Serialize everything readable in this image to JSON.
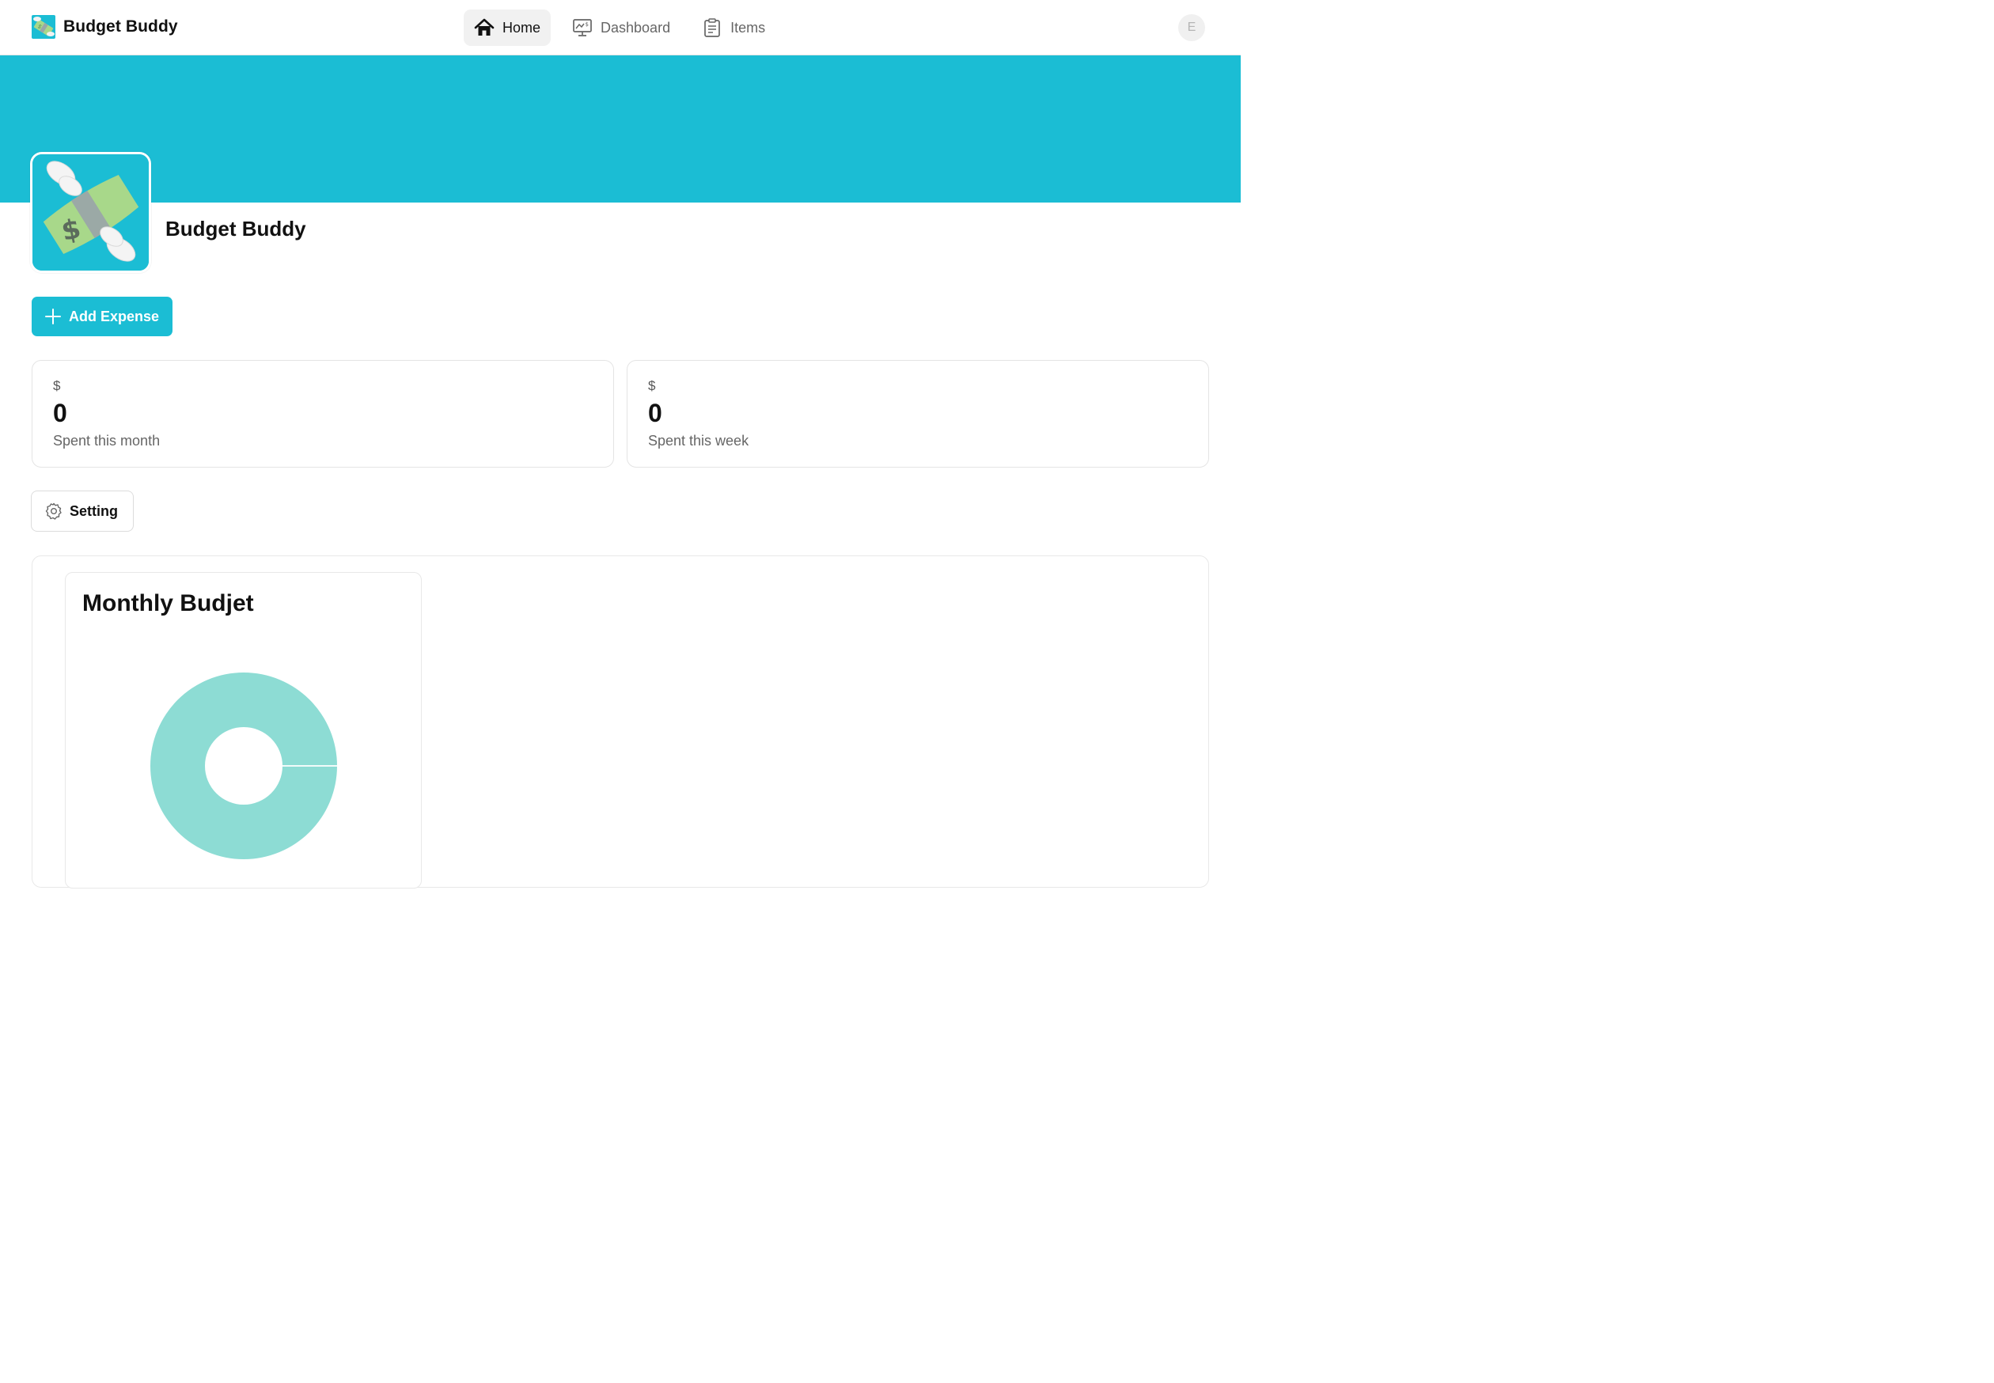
{
  "brand": {
    "name": "Budget Buddy",
    "logo_icon": "flying-money-icon"
  },
  "nav": {
    "items": [
      {
        "label": "Home",
        "icon": "home-icon",
        "active": true
      },
      {
        "label": "Dashboard",
        "icon": "dashboard-monitor-icon",
        "active": false
      },
      {
        "label": "Items",
        "icon": "clipboard-icon",
        "active": false
      }
    ]
  },
  "user": {
    "avatar_initial": "E"
  },
  "colors": {
    "accent": "#1bbdd4",
    "chart": "#8ddcd4"
  },
  "app": {
    "title": "Budget Buddy",
    "icon": "flying-money-icon"
  },
  "actions": {
    "add_expense_label": "Add Expense",
    "setting_label": "Setting"
  },
  "stats": [
    {
      "currency": "$",
      "value": "0",
      "label": "Spent this month"
    },
    {
      "currency": "$",
      "value": "0",
      "label": "Spent this week"
    }
  ],
  "chart_data": {
    "type": "pie",
    "title": "Monthly Budjet",
    "variant": "donut",
    "values": [
      100,
      0
    ],
    "colors": [
      "#8ddcd4",
      "#8ddcd4"
    ]
  }
}
